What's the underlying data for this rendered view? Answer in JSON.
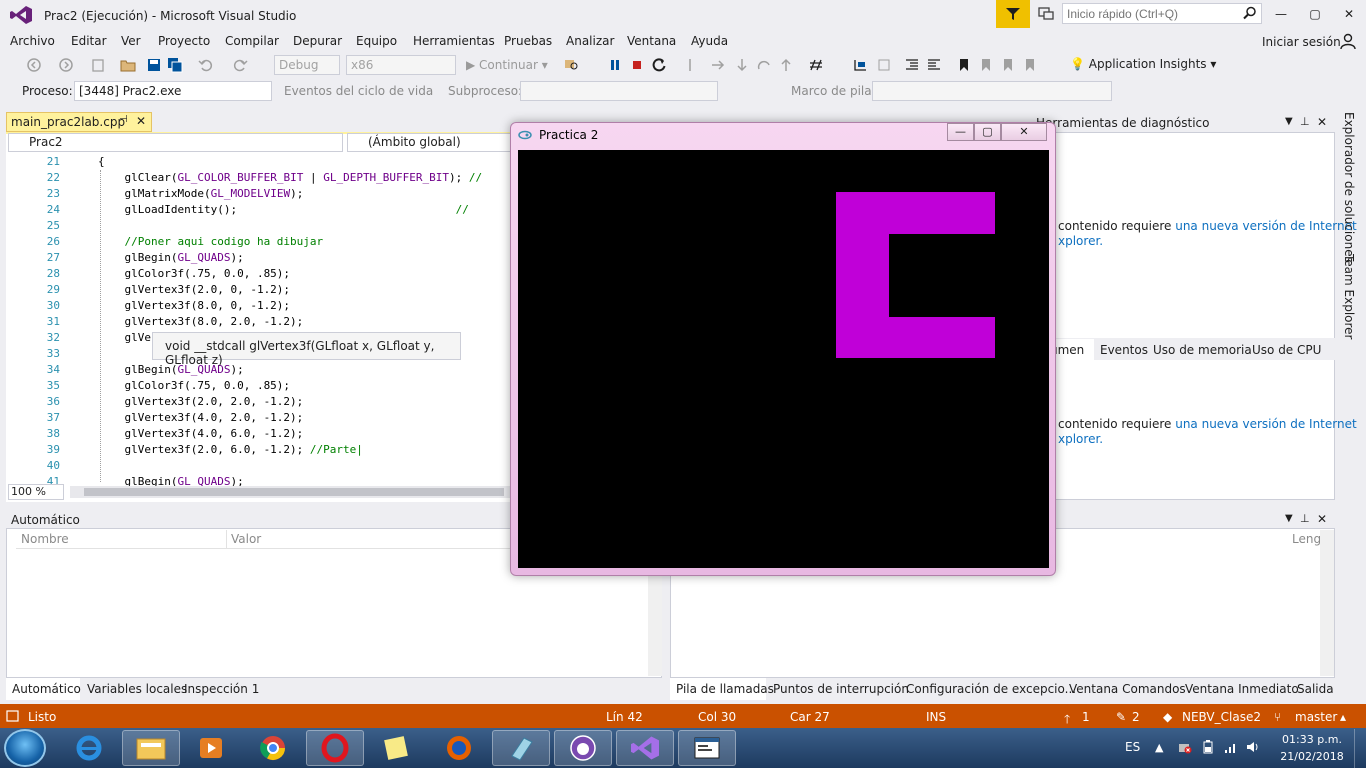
{
  "window": {
    "title": "Prac2 (Ejecución) - Microsoft Visual Studio",
    "quick_launch_placeholder": "Inicio rápido (Ctrl+Q)",
    "minimize": "—",
    "maximize": "▢",
    "close": "✕"
  },
  "menu": [
    "Archivo",
    "Editar",
    "Ver",
    "Proyecto",
    "Compilar",
    "Depurar",
    "Equipo",
    "Herramientas",
    "Pruebas",
    "Analizar",
    "Ventana",
    "Ayuda"
  ],
  "signin": "Iniciar sesión",
  "toolbar": {
    "config": "Debug",
    "platform": "x86",
    "continue": "Continuar",
    "app_insights": "Application Insights"
  },
  "process_bar": {
    "process_label": "Proceso:",
    "process_value": "[3448] Prac2.exe",
    "events_label": "Eventos del ciclo de vida",
    "thread_label": "Subproceso:",
    "stack_label": "Marco de pila:"
  },
  "editor": {
    "tab_name": "main_prac2lab.cpp",
    "pin": "⊣",
    "close": "✕",
    "nav_project": "Prac2",
    "nav_scope": "(Ámbito global)",
    "zoom": "100 %",
    "tooltip": "void __stdcall glVertex3f(GLfloat x, GLfloat y, GLfloat z)",
    "lines": [
      {
        "n": "21",
        "code": "{"
      },
      {
        "n": "22",
        "code": "    glClear(GL_COLOR_BUFFER_BIT | GL_DEPTH_BUFFER_BIT); //"
      },
      {
        "n": "23",
        "code": "    glMatrixMode(GL_MODELVIEW);"
      },
      {
        "n": "24",
        "code": "    glLoadIdentity();                                 //"
      },
      {
        "n": "25",
        "code": ""
      },
      {
        "n": "26",
        "code": "    //Poner aqui codigo ha dibujar"
      },
      {
        "n": "27",
        "code": "    glBegin(GL_QUADS);"
      },
      {
        "n": "28",
        "code": "    glColor3f(.75, 0.0, .85);"
      },
      {
        "n": "29",
        "code": "    glVertex3f(2.0, 0, -1.2);"
      },
      {
        "n": "30",
        "code": "    glVertex3f(8.0, 0, -1.2);"
      },
      {
        "n": "31",
        "code": "    glVertex3f(8.0, 2.0, -1.2);"
      },
      {
        "n": "32",
        "code": "    glVe"
      },
      {
        "n": "33",
        "code": ""
      },
      {
        "n": "34",
        "code": "    glBegin(GL_QUADS);"
      },
      {
        "n": "35",
        "code": "    glColor3f(.75, 0.0, .85);"
      },
      {
        "n": "36",
        "code": "    glVertex3f(2.0, 2.0, -1.2);"
      },
      {
        "n": "37",
        "code": "    glVertex3f(4.0, 2.0, -1.2);"
      },
      {
        "n": "38",
        "code": "    glVertex3f(4.0, 6.0, -1.2);"
      },
      {
        "n": "39",
        "code": "    glVertex3f(2.0, 6.0, -1.2); //Parte|"
      },
      {
        "n": "40",
        "code": ""
      },
      {
        "n": "41",
        "code": "    glBegin(GL_QUADS);"
      }
    ]
  },
  "diagnostics": {
    "title": "Herramientas de diagnóstico",
    "msg_prefix": "contenido requiere ",
    "msg_link": "una nueva versión de Internet",
    "msg_link2": "xplorer.",
    "tabs": [
      "umen",
      "Eventos",
      "Uso de memoria",
      "Uso de CPU"
    ]
  },
  "side_tabs": [
    "Explorador de soluciones",
    "Team Explorer"
  ],
  "autos": {
    "title": "Automático",
    "col_name": "Nombre",
    "col_value": "Valor",
    "tabs": [
      "Automático",
      "Variables locales",
      "Inspección 1"
    ]
  },
  "callstack": {
    "col_lang": "Leng",
    "tabs": [
      "Pila de llamadas",
      "Puntos de interrupción",
      "Configuración de excepcio...",
      "Ventana Comandos",
      "Ventana Inmediato",
      "Salida"
    ]
  },
  "status": {
    "ready": "Listo",
    "line": "Lín 42",
    "col": "Col 30",
    "char": "Car 27",
    "ins": "INS",
    "up_count": "1",
    "edit_count": "2",
    "repo": "NEBV_Clase2",
    "branch": "master"
  },
  "gl_window": {
    "title": "Practica 2",
    "shape_color": "#c000d8"
  },
  "taskbar": {
    "lang": "ES",
    "time": "01:33 p.m.",
    "date": "21/02/2018"
  },
  "colors": {
    "status_bar": "#ca5100",
    "accent": "#007acc",
    "tab_active": "#fff29d"
  }
}
